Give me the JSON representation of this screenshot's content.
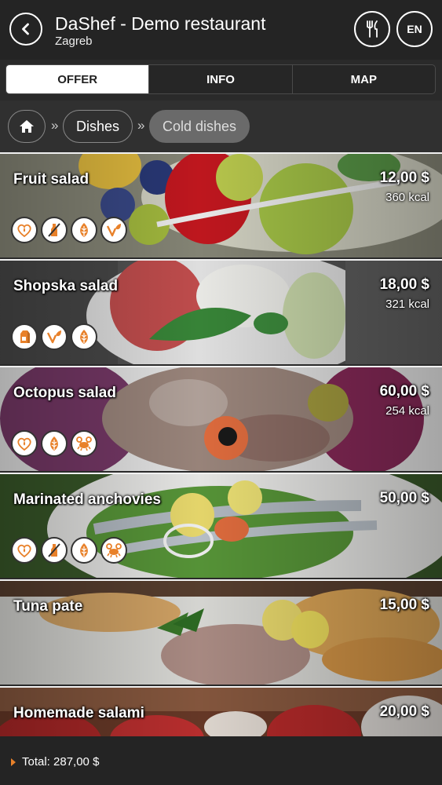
{
  "header": {
    "title": "DaShef - Demo restaurant",
    "subtitle": "Zagreb",
    "back_icon": "chevron-left-icon",
    "menu_icon": "fork-knife-icon",
    "language": "EN"
  },
  "tabs": [
    {
      "label": "OFFER",
      "active": true
    },
    {
      "label": "INFO",
      "active": false
    },
    {
      "label": "MAP",
      "active": false
    }
  ],
  "breadcrumb": {
    "home_icon": "home-icon",
    "separator": "»",
    "items": [
      "Dishes",
      "Cold dishes"
    ]
  },
  "dishes": [
    {
      "name": "Fruit salad",
      "price": "12,00 $",
      "kcal": "360 kcal",
      "icons": [
        "heart-drop-icon",
        "bottle-icon",
        "leaf-icon",
        "v-leaf-icon"
      ]
    },
    {
      "name": "Shopska salad",
      "price": "18,00 $",
      "kcal": "321 kcal",
      "icons": [
        "milk-carton-icon",
        "v-leaf-icon",
        "leaf-icon"
      ]
    },
    {
      "name": "Octopus salad",
      "price": "60,00 $",
      "kcal": "254 kcal",
      "icons": [
        "heart-drop-icon",
        "leaf-icon",
        "crab-icon"
      ]
    },
    {
      "name": "Marinated anchovies",
      "price": "50,00 $",
      "kcal": "",
      "icons": [
        "heart-drop-icon",
        "bottle-icon",
        "leaf-icon",
        "crab-icon"
      ]
    },
    {
      "name": "Tuna pate",
      "price": "15,00 $",
      "kcal": "",
      "icons": []
    },
    {
      "name": "Homemade salami",
      "price": "20,00 $",
      "kcal": "",
      "icons": []
    }
  ],
  "footer": {
    "total": "Total: 287,00 $"
  },
  "colors": {
    "accent": "#e8812a",
    "header_bg": "#242424"
  }
}
